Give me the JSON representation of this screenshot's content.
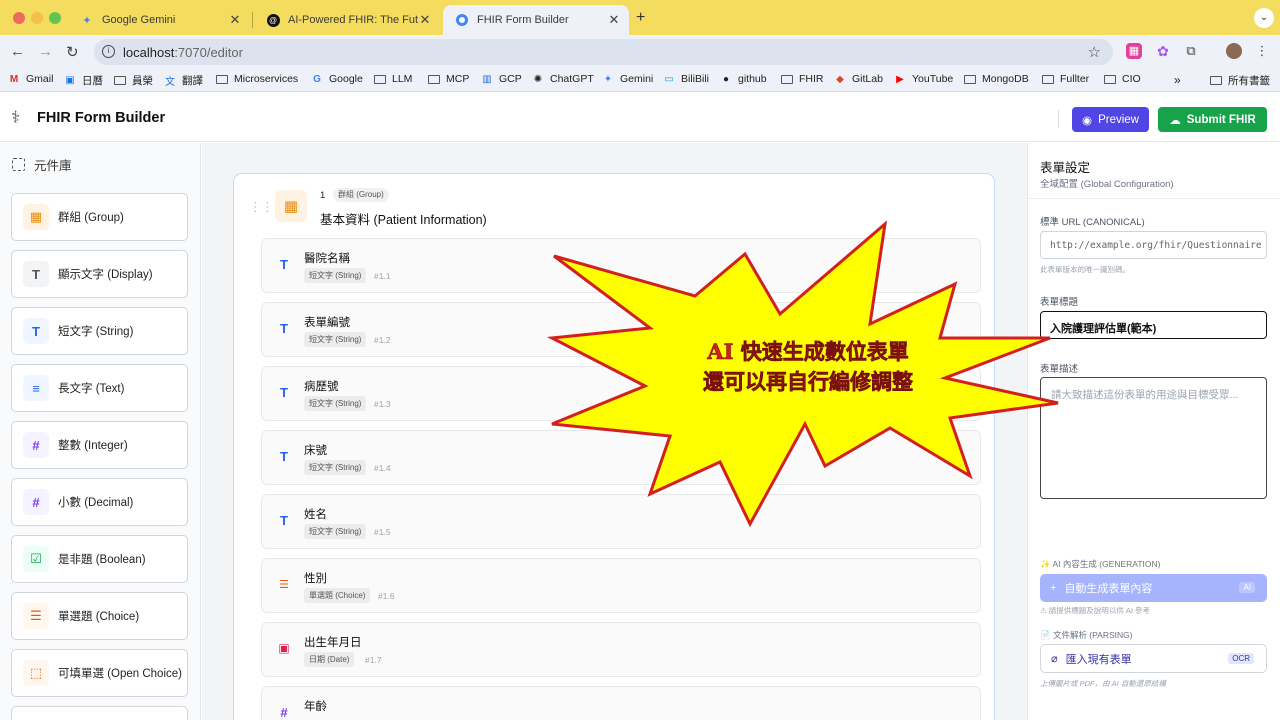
{
  "browser": {
    "tabs": [
      {
        "title": "Google Gemini",
        "icon": "gemini-icon"
      },
      {
        "title": "AI-Powered FHIR: The Future",
        "icon": "article-icon"
      },
      {
        "title": "FHIR Form Builder",
        "icon": "chrome-icon",
        "active": true
      }
    ],
    "url": {
      "host": "localhost",
      "path": ":7070/editor"
    },
    "bookmarks": [
      "Gmail",
      "日曆",
      "員榮",
      "翻譯",
      "Microservices",
      "Google",
      "LLM",
      "MCP",
      "GCP",
      "ChatGPT",
      "Gemini",
      "BiliBili",
      "github",
      "FHIR",
      "GitLab",
      "YouTube",
      "MongoDB",
      "Fullter",
      "CIO"
    ],
    "overflow_label": "»",
    "all_bookmarks_label": "所有書籤"
  },
  "app": {
    "title": "FHIR Form Builder",
    "preview_label": "Preview",
    "submit_label": "Submit FHIR",
    "accent": "#4f46e5",
    "submit_color": "#16a34a"
  },
  "sidebar": {
    "title": "元件庫",
    "items": [
      {
        "label": "群組 (Group)",
        "icon": "▦"
      },
      {
        "label": "顯示文字 (Display)",
        "icon": "T"
      },
      {
        "label": "短文字 (String)",
        "icon": "T"
      },
      {
        "label": "長文字 (Text)",
        "icon": "≡"
      },
      {
        "label": "整數 (Integer)",
        "icon": "#"
      },
      {
        "label": "小數 (Decimal)",
        "icon": "#"
      },
      {
        "label": "是非題 (Boolean)",
        "icon": "☑"
      },
      {
        "label": "單選題 (Choice)",
        "icon": "☰"
      },
      {
        "label": "可填單選 (Open Choice)",
        "icon": "⬚"
      }
    ]
  },
  "group": {
    "number": "1",
    "badge": "群組 (Group)",
    "title": "基本資料 (Patient Information)"
  },
  "questions": [
    {
      "title": "醫院名稱",
      "type": "短文字 (String)",
      "id": "#1.1",
      "icon": "T"
    },
    {
      "title": "表單編號",
      "type": "短文字 (String)",
      "id": "#1.2",
      "icon": "T"
    },
    {
      "title": "病歷號",
      "type": "短文字 (String)",
      "id": "#1.3",
      "icon": "T"
    },
    {
      "title": "床號",
      "type": "短文字 (String)",
      "id": "#1.4",
      "icon": "T"
    },
    {
      "title": "姓名",
      "type": "短文字 (String)",
      "id": "#1.5",
      "icon": "T"
    },
    {
      "title": "性別",
      "type": "單選題 (Choice)",
      "id": "#1.6",
      "icon": "☰"
    },
    {
      "title": "出生年月日",
      "type": "日期 (Date)",
      "id": "#1.7",
      "icon": "▣"
    },
    {
      "title": "年齡",
      "type": "",
      "id": "",
      "icon": "#"
    }
  ],
  "settings": {
    "title": "表單設定",
    "subtitle": "全域配置 (Global Configuration)",
    "canonical_label": "標準 URL (CANONICAL)",
    "canonical_value": "http://example.org/fhir/Questionnaire",
    "canonical_hint": "此表單版本的唯一識別碼。",
    "title_label": "表單標題",
    "title_value": "入院護理評估單(範本)",
    "desc_label": "表單描述",
    "desc_placeholder": "請大致描述這份表單的用途與目標受眾...",
    "ai_section_label": "✨ AI 內容生成 (GENERATION)",
    "ai_button_label": "自動生成表單內容",
    "ai_tag": "AI",
    "ai_hint": "⚠ 請提供標題及說明以供 AI 參考",
    "ocr_section_label": "📄 文件解析 (PARSING)",
    "ocr_button_label": "匯入現有表單",
    "ocr_tag": "OCR",
    "ocr_hint": "上傳圖片或 PDF，由 AI 自動還原結構"
  },
  "callout": {
    "line1": "AI 快速生成數位表單",
    "line2": "還可以再自行編修調整",
    "fill": "#ffff00",
    "stroke": "#d21f1f"
  }
}
